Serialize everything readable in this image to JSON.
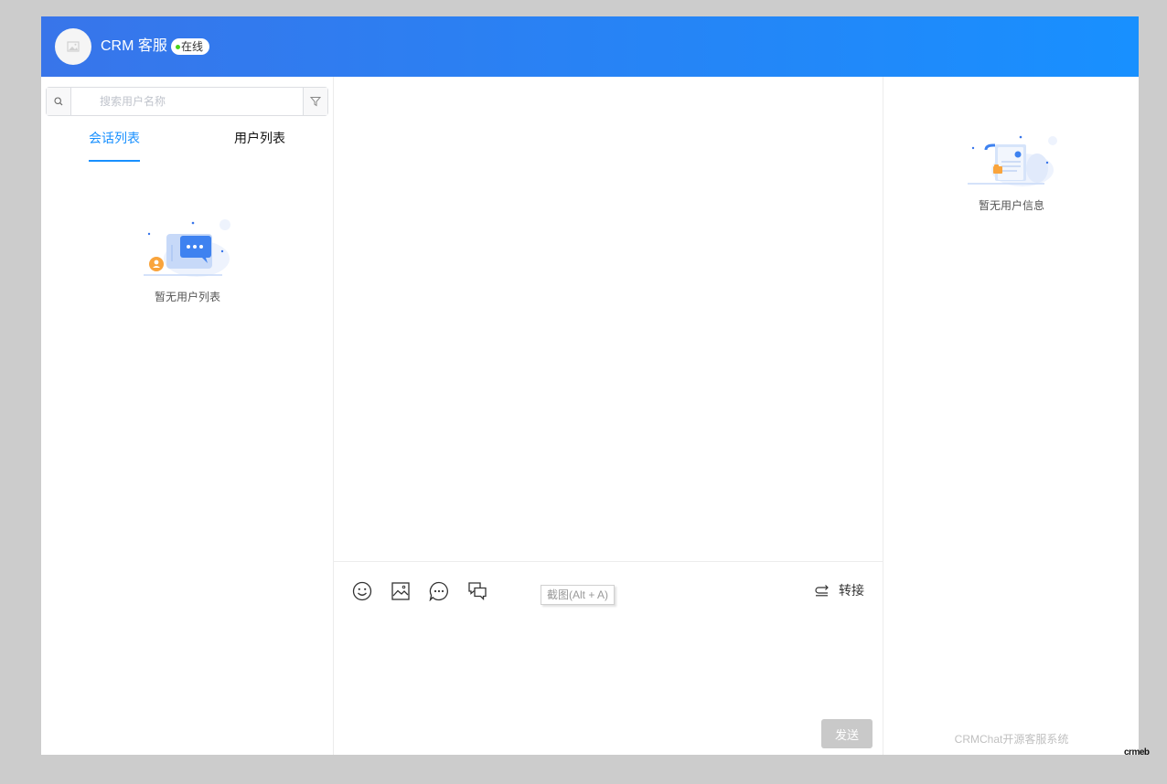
{
  "header": {
    "title": "CRM 客服",
    "status": "在线",
    "status_color": "#48d21d",
    "gradient_start": "#3875ea",
    "gradient_end": "#1890ff"
  },
  "sidebar": {
    "search_placeholder": "搜索用户名称",
    "tabs": [
      {
        "label": "会话列表",
        "active": true
      },
      {
        "label": "用户列表",
        "active": false
      }
    ],
    "empty_text": "暂无用户列表"
  },
  "compose": {
    "tools": [
      "emoji-icon",
      "image-icon",
      "quick-reply-icon",
      "chat-history-icon"
    ],
    "tooltip": "截图(Alt + A)",
    "transfer_label": "转接",
    "send_label": "发送"
  },
  "user_info": {
    "empty_text": "暂无用户信息",
    "footer": "CRMChat开源客服系统"
  },
  "brand_mark": "crmeb",
  "accent_color": "#1890ff"
}
